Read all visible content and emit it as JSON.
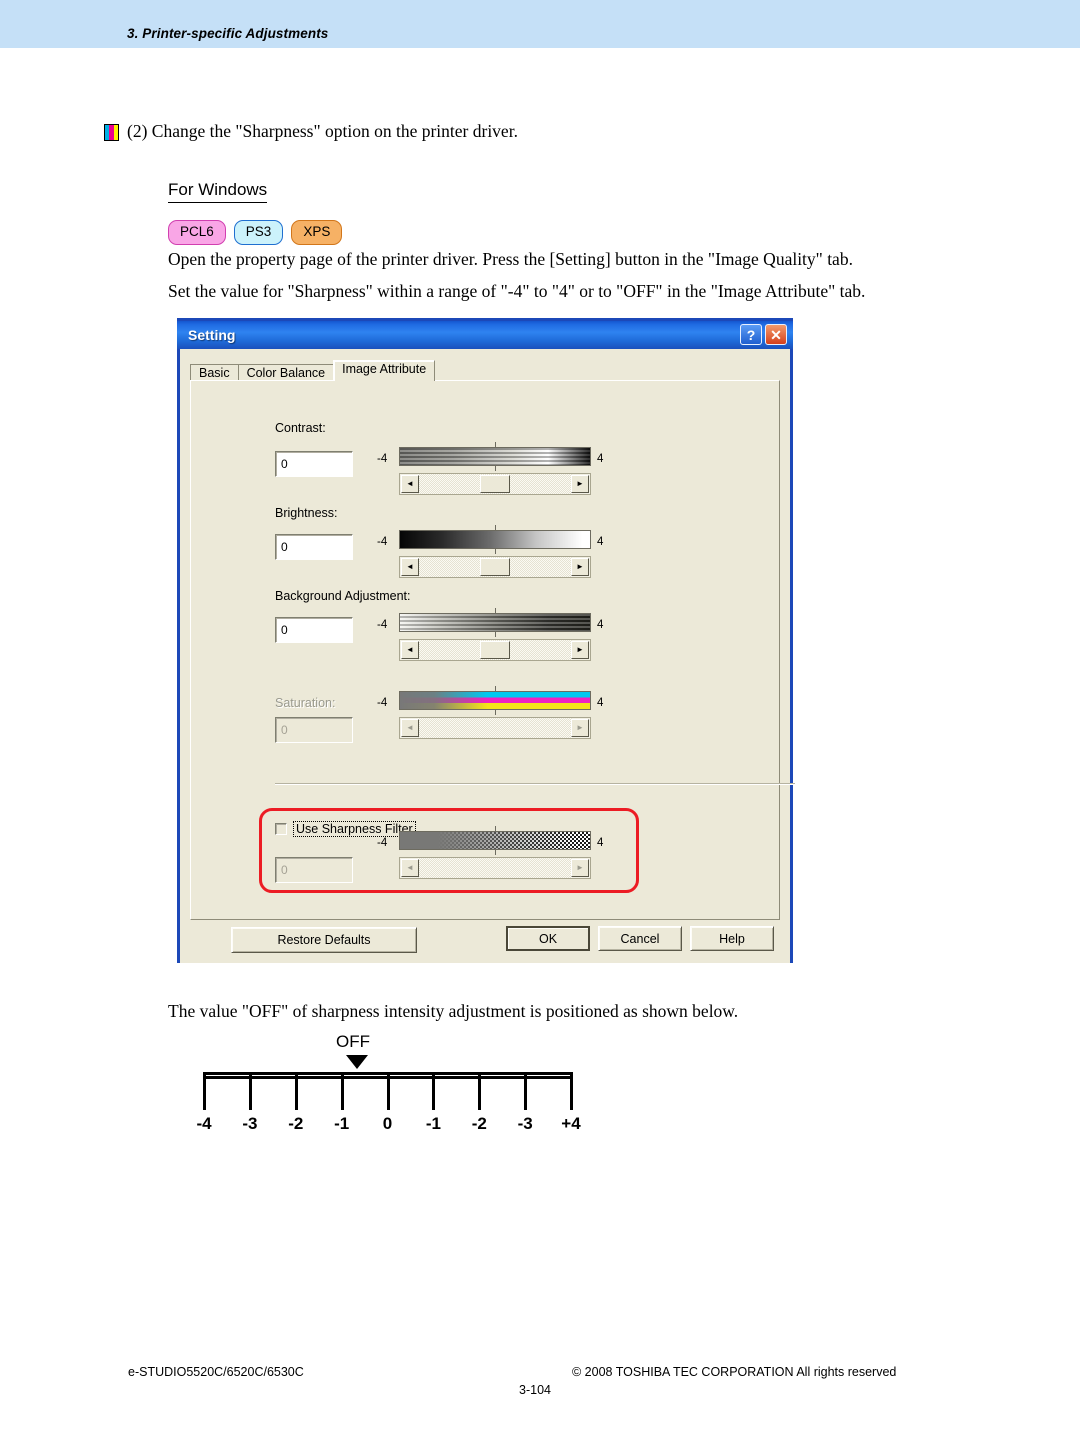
{
  "header": {
    "chapter_title": "3. Printer-specific Adjustments",
    "band_color": "#c5e0f7"
  },
  "step": {
    "text": "(2) Change the \"Sharpness\" option on the printer driver.",
    "bullet_colors": [
      "#00b0e6",
      "#ec008c",
      "#fff200"
    ]
  },
  "section": {
    "heading": "For Windows"
  },
  "badges": [
    {
      "label": "PCL6",
      "bg": "#f9a6e6",
      "border": "#d13fb0"
    },
    {
      "label": "PS3",
      "bg": "#ccf2fb",
      "border": "#1f6fd0"
    },
    {
      "label": "XPS",
      "bg": "#f6b165",
      "border": "#d2761a"
    }
  ],
  "paragraphs": {
    "open": "Open the property page of the printer driver. Press the [Setting] button in the \"Image Quality\" tab.",
    "set": "Set the value for \"Sharpness\" within a range of \"-4\" to \"4\" or to \"OFF\" in the \"Image Attribute\" tab.",
    "off_note": "The value \"OFF\" of sharpness intensity adjustment is positioned as shown below."
  },
  "dialog": {
    "title": "Setting",
    "titlebar_color": "#2f83f0",
    "help_button": "?",
    "close_button": "✕",
    "tabs": [
      {
        "label": "Basic",
        "active": false
      },
      {
        "label": "Color Balance",
        "active": false
      },
      {
        "label": "Image Attribute",
        "active": true
      }
    ],
    "controls": [
      {
        "label": "Contrast:",
        "value": "0",
        "min_label": "-4",
        "max_label": "4",
        "enabled": true
      },
      {
        "label": "Brightness:",
        "value": "0",
        "min_label": "-4",
        "max_label": "4",
        "enabled": true
      },
      {
        "label": "Background Adjustment:",
        "value": "0",
        "min_label": "-4",
        "max_label": "4",
        "enabled": true
      },
      {
        "label": "Saturation:",
        "value": "0",
        "min_label": "-4",
        "max_label": "4",
        "enabled": false
      }
    ],
    "sharpness": {
      "checkbox_label": "Use Sharpness Filter",
      "checked": false,
      "value": "0",
      "min_label": "-4",
      "max_label": "4",
      "enabled": false,
      "highlight_color": "#ec1c24"
    },
    "arrow_left": "◄",
    "arrow_right": "►",
    "buttons": {
      "restore": "Restore Defaults",
      "ok": "OK",
      "cancel": "Cancel",
      "help": "Help"
    }
  },
  "scale": {
    "off_label": "OFF",
    "marker_position_label": "between -1 and 0",
    "ticks": [
      "-4",
      "-3",
      "-2",
      "-1",
      "0",
      "-1",
      "-2",
      "-3",
      "+4"
    ]
  },
  "footer": {
    "model": "e-STUDIO5520C/6520C/6530C",
    "copyright": "© 2008 TOSHIBA TEC CORPORATION All rights reserved",
    "page": "3-104"
  }
}
